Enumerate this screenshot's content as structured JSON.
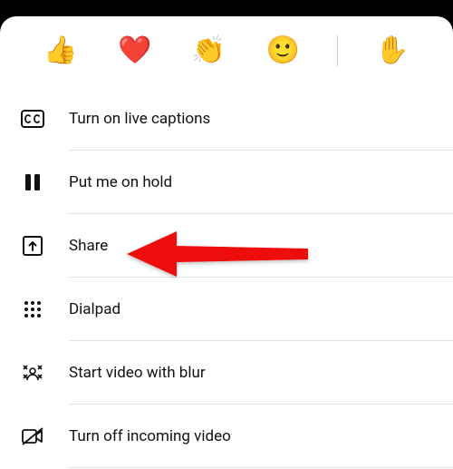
{
  "reactions": {
    "like_glyph": "👍",
    "heart_glyph": "❤️",
    "applause_glyph": "👏",
    "laugh_glyph": "🙂",
    "raise_hand_glyph": "✋"
  },
  "menu": {
    "live_captions": "Turn on live captions",
    "hold": "Put me on hold",
    "share": "Share",
    "dialpad": "Dialpad",
    "blur": "Start video with blur",
    "turn_off_incoming": "Turn off incoming video"
  }
}
